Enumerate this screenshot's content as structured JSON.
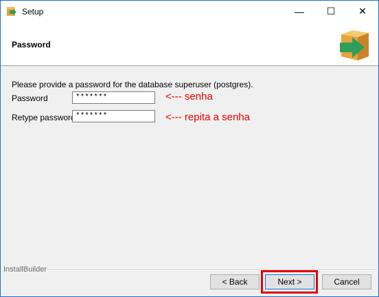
{
  "window": {
    "title": "Setup",
    "minimize_glyph": "—",
    "maximize_glyph": "☐",
    "close_glyph": "✕"
  },
  "header": {
    "title": "Password",
    "icon": "install-box-arrow-icon"
  },
  "form": {
    "description": "Please provide a password for the database superuser (postgres).",
    "password_label": "Password",
    "password_value": "*******",
    "retype_label": "Retype password",
    "retype_value": "*******"
  },
  "annotations": {
    "password_note": "<--- senha",
    "retype_note": "<--- repita a senha",
    "color": "#e30000"
  },
  "footer": {
    "brand": "InstallBuilder",
    "back_label": "< Back",
    "next_label": "Next >",
    "cancel_label": "Cancel"
  }
}
